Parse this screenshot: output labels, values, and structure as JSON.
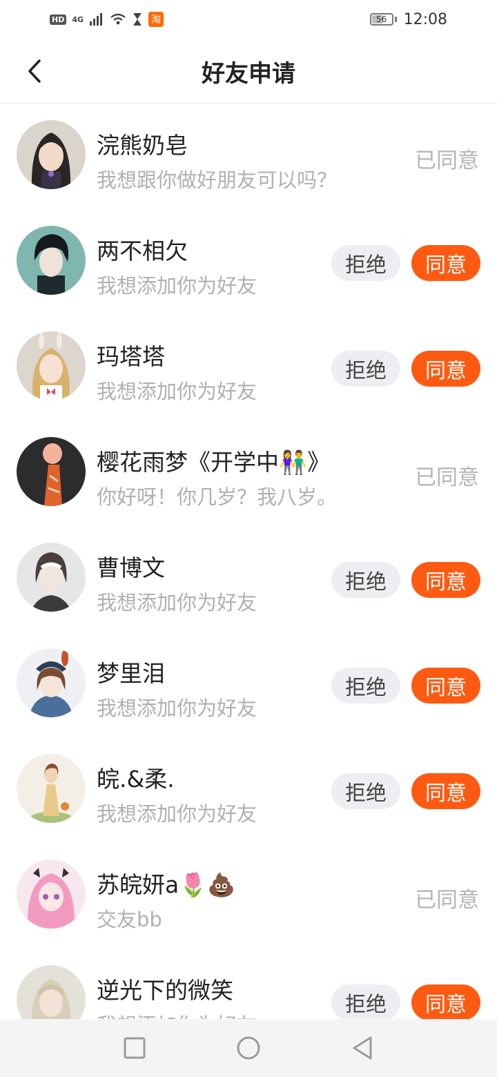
{
  "status_bar": {
    "hd": "HD",
    "network": "4G",
    "taobao": "淘",
    "battery_level": "56",
    "time": "12:08"
  },
  "header": {
    "title": "好友申请"
  },
  "requests": [
    {
      "name": "浣熊奶皂",
      "message": "我想跟你做好朋友可以吗？",
      "status": "已同意"
    },
    {
      "name": "两不相欠",
      "message": "我想添加你为好友",
      "reject_label": "拒绝",
      "accept_label": "同意"
    },
    {
      "name": "玛塔塔",
      "message": "我想添加你为好友",
      "reject_label": "拒绝",
      "accept_label": "同意"
    },
    {
      "name": "樱花雨梦《开学中👫》",
      "message": "你好呀！你几岁？我八岁。",
      "status": "已同意"
    },
    {
      "name": "曹博文",
      "message": "我想添加你为好友",
      "reject_label": "拒绝",
      "accept_label": "同意"
    },
    {
      "name": "梦里泪",
      "message": "我想添加你为好友",
      "reject_label": "拒绝",
      "accept_label": "同意"
    },
    {
      "name": "皖.&柔.",
      "message": "我想添加你为好友",
      "reject_label": "拒绝",
      "accept_label": "同意"
    },
    {
      "name": "苏皖妍a🌷💩",
      "message": "交友bb",
      "status": "已同意"
    },
    {
      "name": "逆光下的微笑",
      "message": "我想添加你为好友",
      "reject_label": "拒绝",
      "accept_label": "同意"
    }
  ],
  "colors": {
    "accent": "#ff5a12",
    "reject_bg": "#eceef2",
    "muted_text": "#b0b0b0"
  },
  "icons": {
    "back": "chevron-left-icon",
    "nav_recent": "square-icon",
    "nav_home": "circle-icon",
    "nav_back": "triangle-back-icon"
  }
}
